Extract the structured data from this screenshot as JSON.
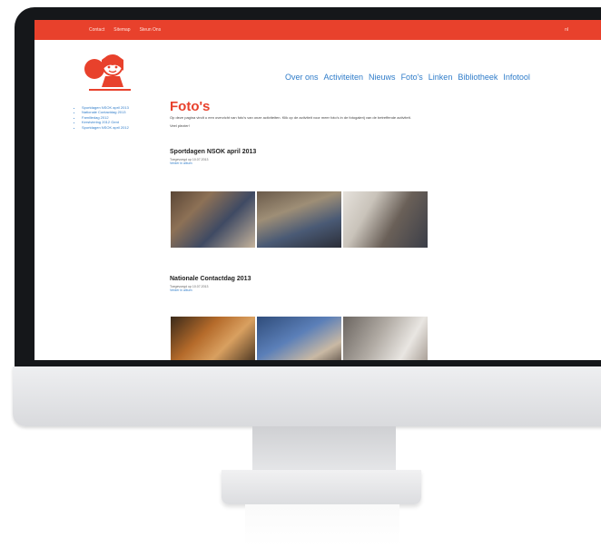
{
  "topbar": {
    "links": [
      "Contact",
      "Sitemap",
      "Steun Ons"
    ],
    "right": "nl"
  },
  "nav": {
    "items": [
      "Over ons",
      "Activiteiten",
      "Nieuws",
      "Foto's",
      "Linken",
      "Bibliotheek",
      "Infotool"
    ]
  },
  "sidebar": {
    "items": [
      "Sportdagen NSOK april 2013",
      "Nationale Contactdag 2013",
      "Familiedag 2012",
      "Kerstviering 2012 Gent",
      "Sportdagen NSOK april 2012"
    ]
  },
  "main": {
    "title": "Foto's",
    "intro": "Op deze pagina vindt u een overzicht van foto's van onze activiteiten. Klik op de activiteit voor meer foto's in de fotogalerij van de betreffende activiteit.",
    "welcome": "Veel plezier!"
  },
  "sections": [
    {
      "title": "Sportdagen NSOK april 2013",
      "meta": "Toegevoegd op 10.07.2013",
      "link": "Verder in album"
    },
    {
      "title": "Nationale Contactdag 2013",
      "meta": "Toegevoegd op 10.07.2013",
      "link": "Verder in album"
    }
  ],
  "colors": {
    "accent": "#e8412c",
    "link": "#2f7cc9",
    "bezel": "#15171a"
  }
}
